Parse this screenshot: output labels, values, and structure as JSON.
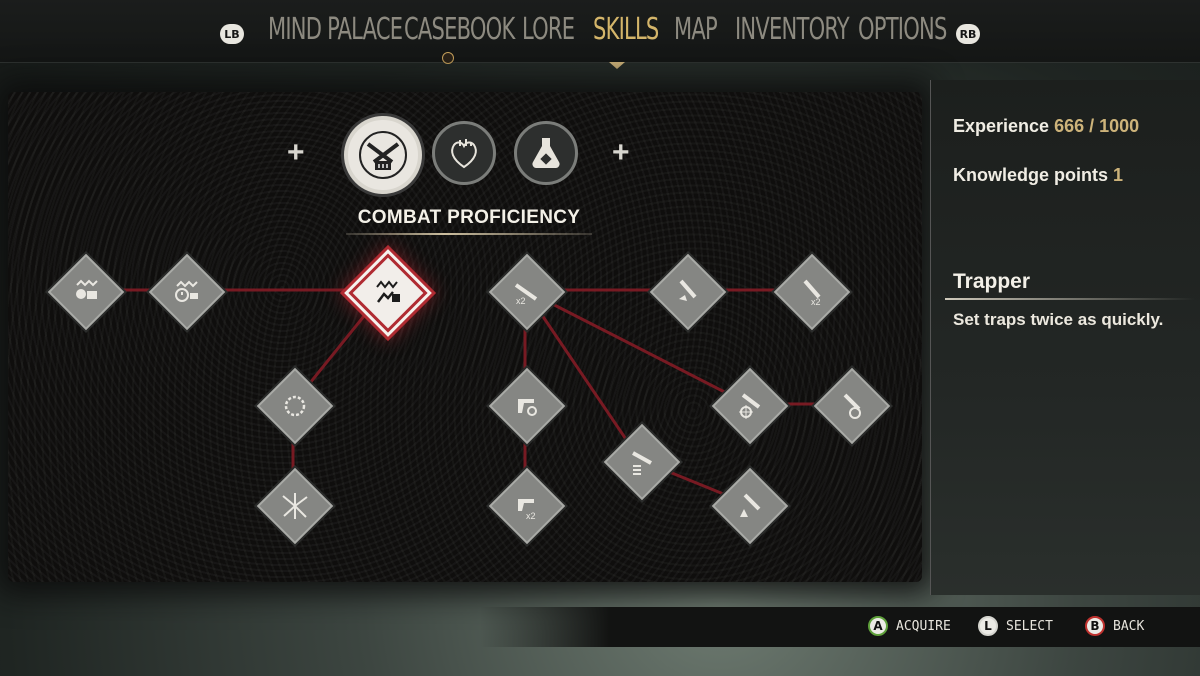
{
  "nav": {
    "lb": "LB",
    "rb": "RB",
    "tabs": [
      {
        "label": "MIND PALACE",
        "active": false
      },
      {
        "label": "CASEBOOK",
        "active": false
      },
      {
        "label": "LORE",
        "active": false
      },
      {
        "label": "SKILLS",
        "active": true
      },
      {
        "label": "MAP",
        "active": false
      },
      {
        "label": "INVENTORY",
        "active": false
      },
      {
        "label": "OPTIONS",
        "active": false
      }
    ]
  },
  "categories": {
    "title": "COMBAT PROFICIENCY",
    "items": [
      {
        "icon": "crossed-pistols-icon",
        "selected": true
      },
      {
        "icon": "anatomical-heart-icon",
        "selected": false
      },
      {
        "icon": "alchemy-flask-icon",
        "selected": false
      }
    ]
  },
  "tree": {
    "nodes": [
      {
        "id": "n1",
        "icon": "skull-trap-icon",
        "badge": ""
      },
      {
        "id": "n2",
        "icon": "bear-trap-timer-icon",
        "badge": ""
      },
      {
        "id": "n3",
        "icon": "trapper-icon",
        "badge": "",
        "selected": true
      },
      {
        "id": "n4",
        "icon": "thorn-ring-icon",
        "badge": ""
      },
      {
        "id": "n5",
        "icon": "shattered-glass-icon",
        "badge": ""
      },
      {
        "id": "n6",
        "icon": "rifle-x2-icon",
        "badge": "x2"
      },
      {
        "id": "n7",
        "icon": "knife-strike-icon",
        "badge": ""
      },
      {
        "id": "n8",
        "icon": "knife-x2-icon",
        "badge": "x2"
      },
      {
        "id": "n9",
        "icon": "revolver-reload-icon",
        "badge": ""
      },
      {
        "id": "n10",
        "icon": "revolver-x2-icon",
        "badge": "x2"
      },
      {
        "id": "n11",
        "icon": "rifle-ammo-icon",
        "badge": ""
      },
      {
        "id": "n12",
        "icon": "rifle-scope-icon",
        "badge": ""
      },
      {
        "id": "n13",
        "icon": "knife-scope-icon",
        "badge": ""
      },
      {
        "id": "n14",
        "icon": "blade-upgrade-icon",
        "badge": ""
      }
    ]
  },
  "side": {
    "experience_label": "Experience",
    "experience_value": "666 / 1000",
    "knowledge_label": "Knowledge points",
    "knowledge_value": "1",
    "skill_name": "Trapper",
    "skill_desc": "Set traps twice as quickly."
  },
  "hints": [
    {
      "key": "A",
      "label": "ACQUIRE",
      "ring": "#5fa13b"
    },
    {
      "key": "L",
      "label": "SELECT",
      "ring": "#ecebe6"
    },
    {
      "key": "B",
      "label": "BACK",
      "ring": "#c0322f"
    }
  ]
}
